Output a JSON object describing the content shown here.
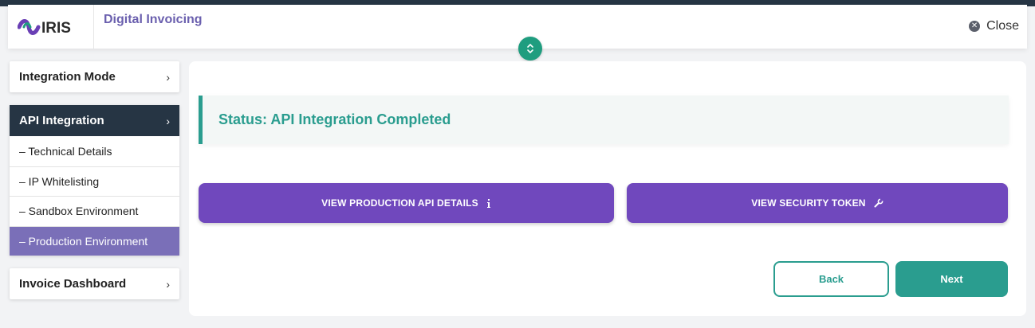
{
  "header": {
    "app_title": "Digital Invoicing",
    "close_label": "Close",
    "logo_text": "IRIS"
  },
  "sidebar": {
    "sections": [
      {
        "label": "Integration Mode",
        "chevron": "›"
      },
      {
        "label": "API Integration",
        "chevron": "›",
        "items": [
          {
            "label": "– Technical Details"
          },
          {
            "label": "– IP Whitelisting"
          },
          {
            "label": "– Sandbox Environment"
          },
          {
            "label": "– Production Environment"
          }
        ]
      },
      {
        "label": "Invoice Dashboard",
        "chevron": "›"
      }
    ]
  },
  "main": {
    "status": "Status: API Integration Completed",
    "production_button": "VIEW PRODUCTION API DETAILS",
    "token_button": "VIEW SECURITY TOKEN",
    "back_label": "Back",
    "next_label": "Next"
  },
  "icons": {
    "close": "close-circle-icon",
    "toggle": "expand-collapse-icon",
    "info": "info-icon",
    "wrench": "wrench-icon",
    "chevron": "chevron-right-icon"
  },
  "colors": {
    "accent_teal": "#2a9d8f",
    "accent_purple": "#7048bd",
    "dark_nav": "#263544",
    "active_item": "#7a6fb8"
  }
}
